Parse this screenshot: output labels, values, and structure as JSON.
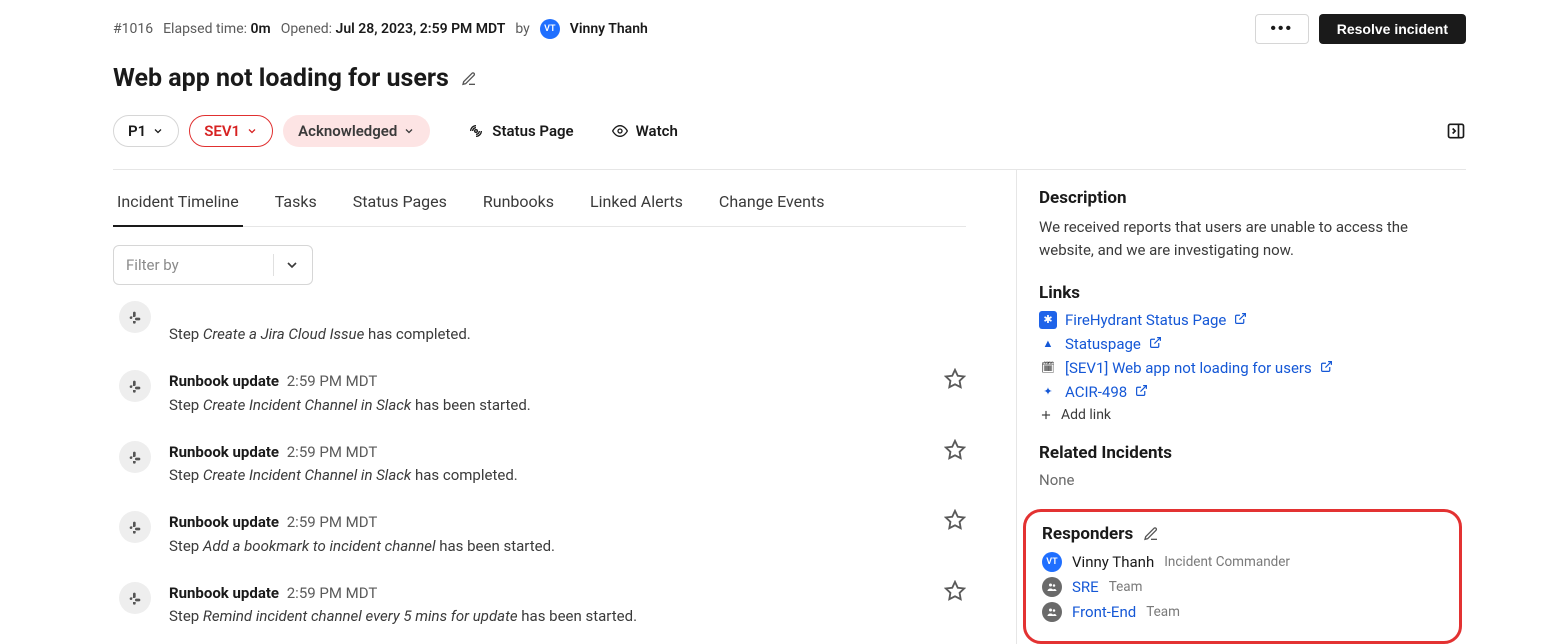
{
  "header": {
    "incident_id": "#1016",
    "elapsed_label": "Elapsed time:",
    "elapsed_value": "0m",
    "opened_label": "Opened:",
    "opened_value": "Jul 28, 2023, 2:59 PM MDT",
    "by_label": "by",
    "author_initials": "VT",
    "author_name": "Vinny Thanh",
    "more_label": "•••",
    "resolve_label": "Resolve incident"
  },
  "title": "Web app not loading for users",
  "badges": {
    "priority": "P1",
    "severity": "SEV1",
    "status": "Acknowledged",
    "status_page": "Status Page",
    "watch": "Watch"
  },
  "tabs": [
    "Incident Timeline",
    "Tasks",
    "Status Pages",
    "Runbooks",
    "Linked Alerts",
    "Change Events"
  ],
  "filter_placeholder": "Filter by",
  "timeline": [
    {
      "title": "",
      "time": "",
      "step_prefix": "Step ",
      "step_name": "Create a Jira Cloud Issue",
      "step_suffix": " has completed.",
      "starred": false,
      "first": true
    },
    {
      "title": "Runbook update",
      "time": "2:59 PM MDT",
      "step_prefix": "Step ",
      "step_name": "Create Incident Channel in Slack",
      "step_suffix": " has been started."
    },
    {
      "title": "Runbook update",
      "time": "2:59 PM MDT",
      "step_prefix": "Step ",
      "step_name": "Create Incident Channel in Slack",
      "step_suffix": " has completed."
    },
    {
      "title": "Runbook update",
      "time": "2:59 PM MDT",
      "step_prefix": "Step ",
      "step_name": "Add a bookmark to incident channel",
      "step_suffix": " has been started."
    },
    {
      "title": "Runbook update",
      "time": "2:59 PM MDT",
      "step_prefix": "Step ",
      "step_name": "Remind incident channel every 5 mins for update",
      "step_suffix": " has been started."
    }
  ],
  "sidebar": {
    "description_h": "Description",
    "description": "We received reports that users are unable to access the website, and we are investigating now.",
    "links_h": "Links",
    "links": [
      {
        "label": "FireHydrant Status Page",
        "icon_bg": "#1e63e9",
        "icon_txt": "✱"
      },
      {
        "label": "Statuspage",
        "icon_bg": "#ffffff",
        "icon_txt": "▲",
        "icon_color": "#1457d6"
      },
      {
        "label": "[SEV1] Web app not loading for users",
        "icon_bg": "#ffffff",
        "icon_txt": "🗓",
        "icon_color": "#1a1a1a"
      },
      {
        "label": "ACIR-498",
        "icon_bg": "#ffffff",
        "icon_txt": "✦",
        "icon_color": "#1457d6"
      }
    ],
    "add_link": "Add link",
    "related_h": "Related Incidents",
    "related_none": "None",
    "responders_h": "Responders",
    "responders": [
      {
        "type": "user",
        "initials": "VT",
        "name": "Vinny Thanh",
        "role": "Incident Commander"
      },
      {
        "type": "team",
        "name": "SRE",
        "role": "Team"
      },
      {
        "type": "team",
        "name": "Front-End",
        "role": "Team"
      }
    ]
  }
}
